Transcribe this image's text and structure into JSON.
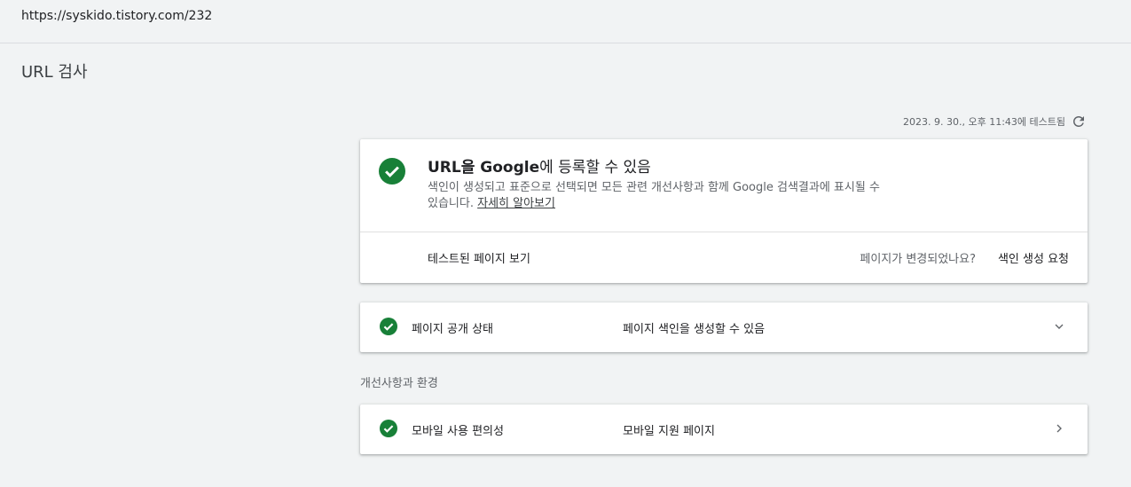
{
  "url_bar": {
    "url": "https://syskido.tistory.com/232"
  },
  "page": {
    "title": "URL 검사"
  },
  "test_info": {
    "tested_at": "2023. 9. 30., 오후 11:43에 테스트됨"
  },
  "main_card": {
    "heading_bold": "URL을 Google",
    "heading_rest": "에 등록할 수 있음",
    "description": "색인이 생성되고 표준으로 선택되면 모든 관련 개선사항과 함께 Google 검색결과에 표시될 수 있습니다. ",
    "learn_more": "자세히 알아보기",
    "view_tested_page": "테스트된 페이지 보기",
    "page_changed_question": "페이지가 변경되었나요?",
    "request_indexing": "색인 생성 요청"
  },
  "availability_row": {
    "label": "페이지 공개 상태",
    "value": "페이지 색인을 생성할 수 있음"
  },
  "enhancements": {
    "heading": "개선사항과 환경",
    "mobile_row": {
      "label": "모바일 사용 편의성",
      "value": "모바일 지원 페이지"
    }
  },
  "colors": {
    "success_green": "#188038",
    "text_primary": "#202124",
    "text_secondary": "#5f6368"
  },
  "icons": [
    "refresh-icon",
    "check-circle-icon",
    "chevron-down-icon",
    "chevron-right-icon"
  ]
}
